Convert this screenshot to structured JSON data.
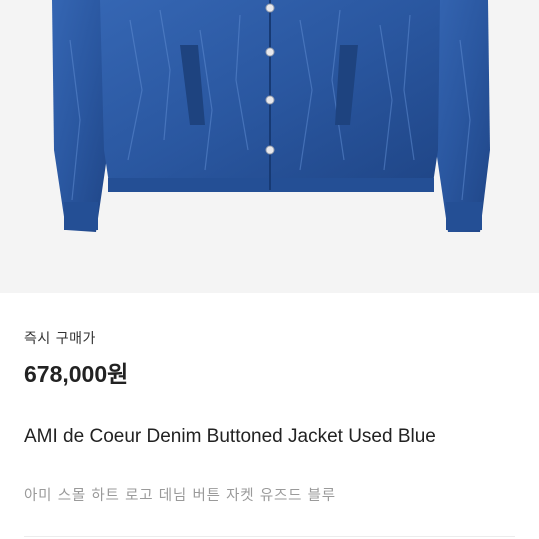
{
  "product": {
    "image_icon": "denim-jacket-photo",
    "price_label": "즉시 구매가",
    "price": "678,000원",
    "name_en": "AMI de Coeur Denim Buttoned Jacket Used Blue",
    "name_ko": "아미 스몰 하트 로고 데님 버튼 자켓 유즈드 블루"
  },
  "colors": {
    "denim": "#2b59a3",
    "denim_dark": "#1d3f7c",
    "background": "#f4f4f4",
    "text": "#222222",
    "subtext": "#9a9a9a"
  }
}
